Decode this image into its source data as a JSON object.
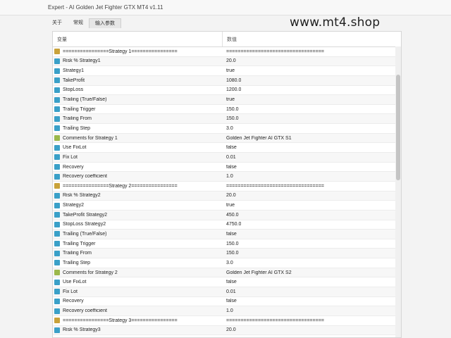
{
  "window": {
    "title": "Expert - AI Golden Jet Fighter GTX MT4 v1.11"
  },
  "watermark": "www.mt4.shop",
  "tabs": [
    {
      "label": "关于"
    },
    {
      "label": "常规"
    },
    {
      "label": "输入参数"
    }
  ],
  "table": {
    "headers": {
      "variable": "变量",
      "value": "数值"
    },
    "rows": [
      {
        "name": "================Strategy 1================",
        "value": "==================================",
        "icon": "separator-icon"
      },
      {
        "name": "Risk % Strategy1",
        "value": "20.0",
        "icon": "number-icon"
      },
      {
        "name": "Strategy1",
        "value": "true",
        "icon": "bool-icon"
      },
      {
        "name": "TakeProfit",
        "value": "1080.0",
        "icon": "number-icon"
      },
      {
        "name": "StopLoss",
        "value": "1200.0",
        "icon": "number-icon"
      },
      {
        "name": "Trailing (True/False)",
        "value": "true",
        "icon": "bool-icon"
      },
      {
        "name": "Trailing Trigger",
        "value": "150.0",
        "icon": "number-icon"
      },
      {
        "name": "Trailing From",
        "value": "150.0",
        "icon": "number-icon"
      },
      {
        "name": "Trailing Step",
        "value": "3.0",
        "icon": "number-icon"
      },
      {
        "name": "Comments for Strategy 1",
        "value": "Golden Jet Fighter AI GTX S1",
        "icon": "string-icon"
      },
      {
        "name": "Use FixLot",
        "value": "false",
        "icon": "bool-icon"
      },
      {
        "name": "Fix Lot",
        "value": "0.01",
        "icon": "number-icon"
      },
      {
        "name": "Recovery",
        "value": "false",
        "icon": "bool-icon"
      },
      {
        "name": "Recovery coefficient",
        "value": "1.0",
        "icon": "number-icon"
      },
      {
        "name": "================Strategy 2================",
        "value": "==================================",
        "icon": "separator-icon"
      },
      {
        "name": "Risk % Strategy2",
        "value": "20.0",
        "icon": "number-icon"
      },
      {
        "name": "Strategy2",
        "value": "true",
        "icon": "bool-icon"
      },
      {
        "name": "TakeProfit Strategy2",
        "value": "450.0",
        "icon": "number-icon"
      },
      {
        "name": "StopLoss Strategy2",
        "value": "4750.0",
        "icon": "number-icon"
      },
      {
        "name": "Trailing (True/False)",
        "value": "false",
        "icon": "bool-icon"
      },
      {
        "name": "Trailing Trigger",
        "value": "150.0",
        "icon": "number-icon"
      },
      {
        "name": "Trailing From",
        "value": "150.0",
        "icon": "number-icon"
      },
      {
        "name": "Trailing Step",
        "value": "3.0",
        "icon": "number-icon"
      },
      {
        "name": "Comments for Strategy 2",
        "value": "Golden Jet Fighter AI GTX S2",
        "icon": "string-icon"
      },
      {
        "name": "Use FixLot",
        "value": "false",
        "icon": "bool-icon"
      },
      {
        "name": "Fix Lot",
        "value": "0.01",
        "icon": "number-icon"
      },
      {
        "name": "Recovery",
        "value": "false",
        "icon": "bool-icon"
      },
      {
        "name": "Recovery coefficient",
        "value": "1.0",
        "icon": "number-icon"
      },
      {
        "name": "================Strategy 3================",
        "value": "==================================",
        "icon": "separator-icon"
      },
      {
        "name": "Risk % Strategy3",
        "value": "20.0",
        "icon": "number-icon"
      }
    ]
  }
}
